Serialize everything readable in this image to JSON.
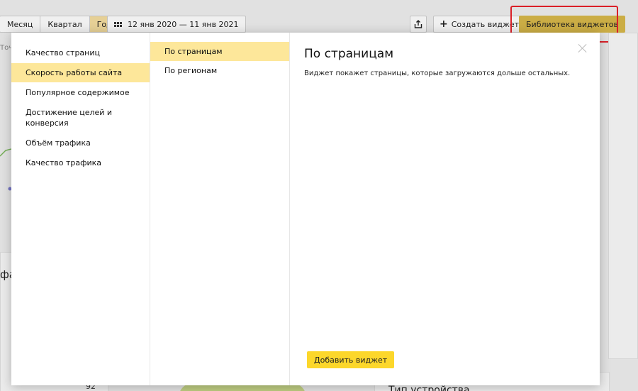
{
  "toolbar": {
    "periods": [
      {
        "label": "Месяц",
        "active": false
      },
      {
        "label": "Квартал",
        "active": false
      },
      {
        "label": "Год",
        "active": true
      }
    ],
    "date_range": "12 янв 2020 — 11 янв 2021",
    "create_widget_label": "Создать виджет",
    "library_label": "Библиотека виджетов"
  },
  "background": {
    "snippet_left": "Точ",
    "snippet_traffic": "фа",
    "snippet_number": "92",
    "snippet_device": "Тип устройства"
  },
  "modal": {
    "categories": [
      {
        "label": "Качество страниц",
        "active": false
      },
      {
        "label": "Скорость работы сайта",
        "active": true
      },
      {
        "label": "Популярное содержимое",
        "active": false
      },
      {
        "label": "Достижение целей и конверсия",
        "active": false
      },
      {
        "label": "Объём трафика",
        "active": false
      },
      {
        "label": "Качество трафика",
        "active": false
      }
    ],
    "widgets": [
      {
        "label": "По страницам",
        "active": true
      },
      {
        "label": "По регионам",
        "active": false
      }
    ],
    "detail": {
      "title": "По страницам",
      "description": "Виджет покажет страницы, которые загружаются дольше остальных.",
      "add_button_label": "Добавить виджет"
    }
  },
  "colors": {
    "accent_yellow": "#fcd72b",
    "active_item": "#fde79a",
    "highlight_red": "#e8222b",
    "library_button": "#d8b84a"
  }
}
